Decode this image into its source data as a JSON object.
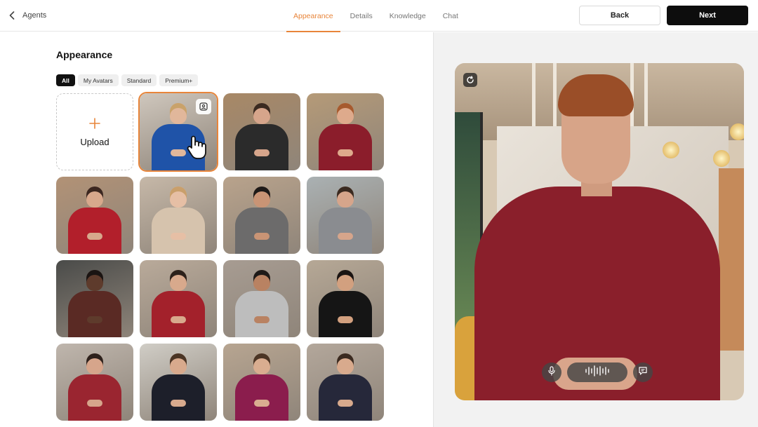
{
  "header": {
    "back_label": "Agents",
    "tabs": [
      {
        "label": "Appearance",
        "active": true
      },
      {
        "label": "Details",
        "active": false
      },
      {
        "label": "Knowledge",
        "active": false
      },
      {
        "label": "Chat",
        "active": false
      }
    ],
    "back_button": "Back",
    "next_button": "Next"
  },
  "appearance": {
    "title": "Appearance",
    "filters": [
      {
        "label": "All",
        "active": true
      },
      {
        "label": "My Avatars",
        "active": false
      },
      {
        "label": "Standard",
        "active": false
      },
      {
        "label": "Premium+",
        "active": false
      }
    ],
    "upload_label": "Upload",
    "upload_icon": "plus-icon",
    "avatars": [
      {
        "bg": "#cfc7bd",
        "top": "#1f53a8",
        "skin": "#e1b79b",
        "hair": "#c9a26a",
        "selected": true
      },
      {
        "bg": "#a88866",
        "top": "#2b2b2b",
        "skin": "#d6a58b",
        "hair": "#3a2a20",
        "selected": false
      },
      {
        "bg": "#b59a78",
        "top": "#8b1d2b",
        "skin": "#deaa8c",
        "hair": "#a65a2e",
        "selected": false
      },
      {
        "bg": "#b29276",
        "top": "#b21f2b",
        "skin": "#d7a88c",
        "hair": "#3b2720",
        "selected": false
      },
      {
        "bg": "#c6b8a8",
        "top": "#d6c3ad",
        "skin": "#e6bfa5",
        "hair": "#c99f6b",
        "selected": false
      },
      {
        "bg": "#b9a38c",
        "top": "#6c6b6b",
        "skin": "#c99475",
        "hair": "#1e1a18",
        "selected": false
      },
      {
        "bg": "#aab1b3",
        "top": "#8a8c90",
        "skin": "#d6a58b",
        "hair": "#3a2a20",
        "selected": false
      },
      {
        "bg": "#4a4b49",
        "top": "#5a2a24",
        "skin": "#5e3b2c",
        "hair": "#1a1412",
        "selected": false
      },
      {
        "bg": "#b9aa9a",
        "top": "#a3212b",
        "skin": "#d8a98c",
        "hair": "#2c211b",
        "selected": false
      },
      {
        "bg": "#a79c92",
        "top": "#bdbdbd",
        "skin": "#b98262",
        "hair": "#1e1a18",
        "selected": false
      },
      {
        "bg": "#b6a896",
        "top": "#151515",
        "skin": "#d2a07f",
        "hair": "#1a1412",
        "selected": false
      },
      {
        "bg": "#bfb6ad",
        "top": "#9a2530",
        "skin": "#d6a58b",
        "hair": "#2d211c",
        "selected": false
      },
      {
        "bg": "#d0cdc6",
        "top": "#1d1f2a",
        "skin": "#d8aa8d",
        "hair": "#4b3525",
        "selected": false
      },
      {
        "bg": "#b7a591",
        "top": "#8b1d4d",
        "skin": "#d9ad90",
        "hair": "#4b3525",
        "selected": false
      },
      {
        "bg": "#b3a79b",
        "top": "#26283a",
        "skin": "#d8aa8d",
        "hair": "#3a2a20",
        "selected": false
      }
    ]
  },
  "preview": {
    "reset_icon": "refresh-icon",
    "mic_icon": "microphone-icon",
    "waveform_icon": "waveform-icon",
    "chat_icon": "chat-bubble-icon"
  },
  "colors": {
    "accent": "#e8853a",
    "primary_button": "#0d0d0d"
  }
}
